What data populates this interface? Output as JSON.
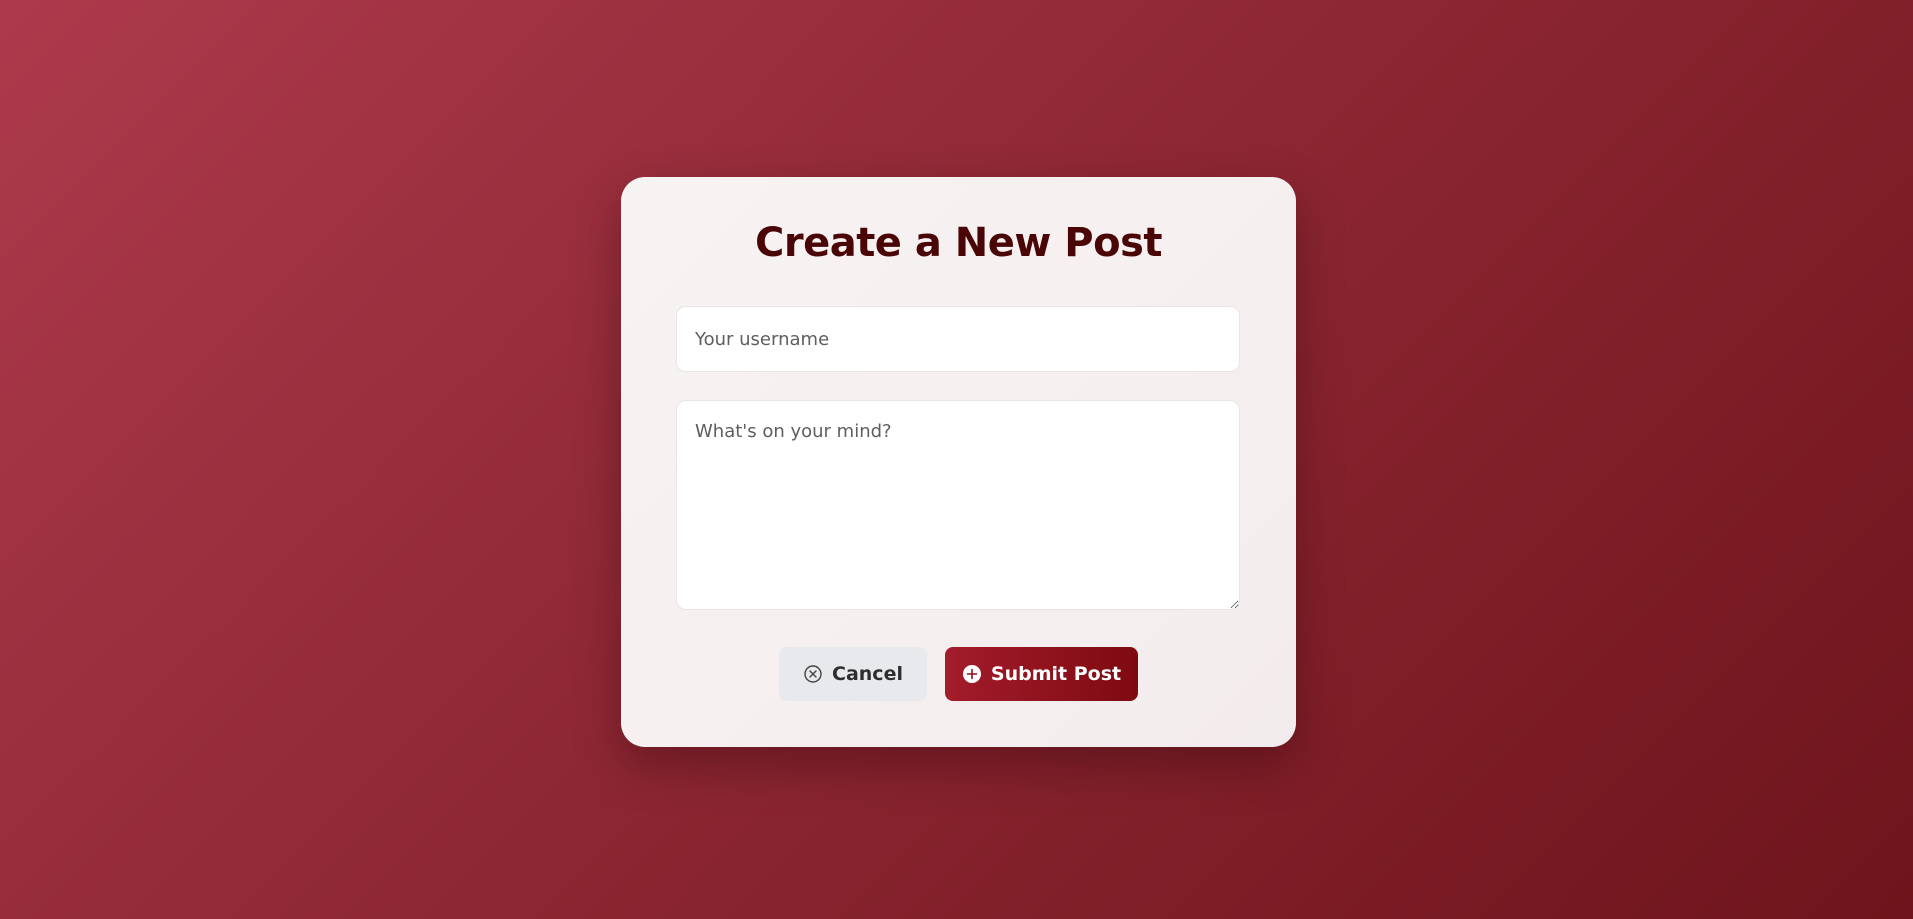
{
  "form": {
    "title": "Create a New Post",
    "username_placeholder": "Your username",
    "username_value": "",
    "content_placeholder": "What's on your mind?",
    "content_value": ""
  },
  "actions": {
    "cancel_label": "Cancel",
    "cancel_icon": "circle-x-icon",
    "submit_label": "Submit Post",
    "submit_icon": "circle-plus-icon"
  },
  "colors": {
    "background_start": "#ad3a4c",
    "background_end": "#6f141c",
    "card_background": "#f8f3f3",
    "title_color": "#4a0606",
    "submit_start": "#a31c2c",
    "submit_end": "#7e0a10",
    "cancel_background": "#e7e9ec"
  }
}
